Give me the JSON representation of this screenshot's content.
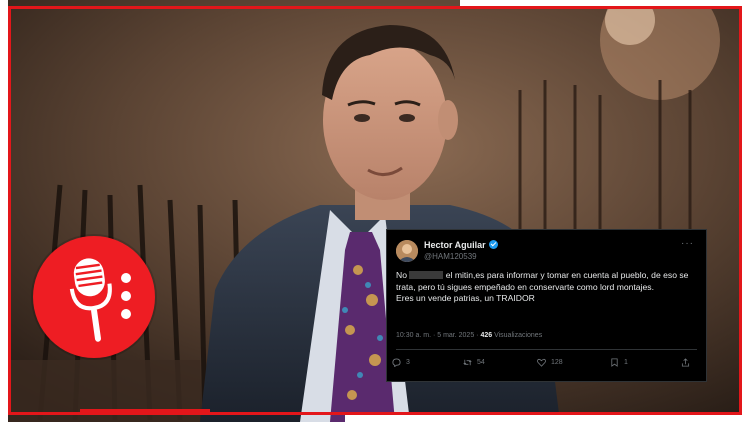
{
  "tweet": {
    "author_name": "Hector Aguilar",
    "handle": "@HAM120539",
    "more_icon": "more-icon",
    "text_start": "No",
    "text_rest": " el mitin,es para informar y tomar en cuenta al pueblo, de eso se trata, pero tú sigues empeñado en conservarte como lord montajes.",
    "text_line2": "Eres un vende patrias, un TRAIDOR",
    "time": "10:30 a. m. · 5 mar. 2025 · ",
    "views_count": "426",
    "views_label": " Visualizaciones",
    "replies": "3",
    "retweets": "54",
    "likes": "128",
    "bookmarks": "1"
  },
  "colors": {
    "frame_red": "#e3161a",
    "logo_red": "#ee1d23",
    "tweet_bg": "#000000",
    "verified_blue": "#1d9bf0"
  },
  "icons": [
    "microphone-icon",
    "verified-badge-icon",
    "reply-icon",
    "retweet-icon",
    "like-icon",
    "bookmark-icon",
    "share-icon"
  ]
}
